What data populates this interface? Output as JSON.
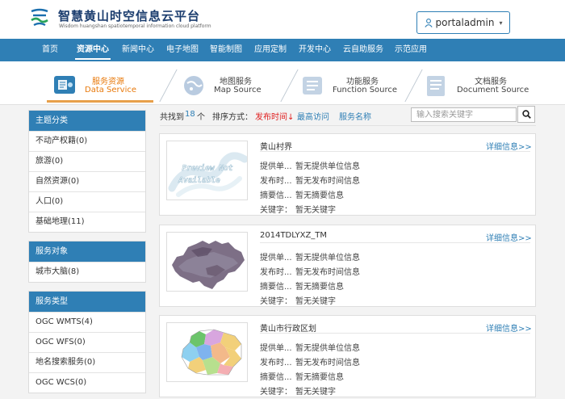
{
  "header": {
    "title": "智慧黄山时空信息云平台",
    "subtitle": "Wisdom huangshan spatiotemporal information cloud platform",
    "user": "portaladmin"
  },
  "nav": {
    "items": [
      {
        "label": "首页"
      },
      {
        "label": "资源中心"
      },
      {
        "label": "新闻中心"
      },
      {
        "label": "电子地图"
      },
      {
        "label": "智能制图"
      },
      {
        "label": "应用定制"
      },
      {
        "label": "开发中心"
      },
      {
        "label": "云自助服务"
      },
      {
        "label": "示范应用"
      }
    ],
    "active_index": 1
  },
  "tabs": [
    {
      "title": "服务资源",
      "subtitle": "Data Service",
      "icon": "data-service-icon"
    },
    {
      "title": "地图服务",
      "subtitle": "Map Source",
      "icon": "map-service-icon"
    },
    {
      "title": "功能服务",
      "subtitle": "Function Source",
      "icon": "function-service-icon"
    },
    {
      "title": "文档服务",
      "subtitle": "Document Source",
      "icon": "document-service-icon"
    }
  ],
  "sidebar": {
    "groups": [
      {
        "title": "主题分类",
        "items": [
          "不动产权籍(0)",
          "旅游(0)",
          "自然资源(0)",
          "人口(0)",
          "基础地理(11)"
        ]
      },
      {
        "title": "服务对象",
        "items": [
          "城市大脑(8)"
        ]
      },
      {
        "title": "服务类型",
        "items": [
          "OGC WMTS(4)",
          "OGC WFS(0)",
          "地名搜索服务(0)",
          "OGC WCS(0)"
        ]
      }
    ]
  },
  "toolbar": {
    "found_prefix": "共找到",
    "count": "18",
    "found_suffix": "个",
    "sort_label": "排序方式：",
    "sort_options": [
      "发布时间↓",
      "最高访问",
      "服务名称"
    ],
    "search_placeholder": "输入搜索关键字"
  },
  "results": [
    {
      "title": "黄山村界",
      "thumb_text": "Preview Not Available",
      "detail": "详细信息>>",
      "fields": [
        {
          "label": "提供单...",
          "value": "暂无提供单位信息"
        },
        {
          "label": "发布时...",
          "value": "暂无发布时间信息"
        },
        {
          "label": "摘要信...",
          "value": "暂无摘要信息"
        },
        {
          "label": "关键字：",
          "value": "暂无关键字"
        }
      ]
    },
    {
      "title": "2014TDLYXZ_TM",
      "detail": "详细信息>>",
      "fields": [
        {
          "label": "提供单...",
          "value": "暂无提供单位信息"
        },
        {
          "label": "发布时...",
          "value": "暂无发布时间信息"
        },
        {
          "label": "摘要信...",
          "value": "暂无摘要信息"
        },
        {
          "label": "关键字：",
          "value": "暂无关键字"
        }
      ]
    },
    {
      "title": "黄山市行政区划",
      "detail": "详细信息>>",
      "fields": [
        {
          "label": "提供单...",
          "value": "暂无提供单位信息"
        },
        {
          "label": "发布时...",
          "value": "暂无发布时间信息"
        },
        {
          "label": "摘要信...",
          "value": "暂无摘要信息"
        },
        {
          "label": "关键字：",
          "value": "暂无关键字"
        }
      ]
    }
  ],
  "colors": {
    "primary": "#2f7fb5",
    "accent_orange": "#e8790b",
    "sort_active": "#e02020"
  }
}
